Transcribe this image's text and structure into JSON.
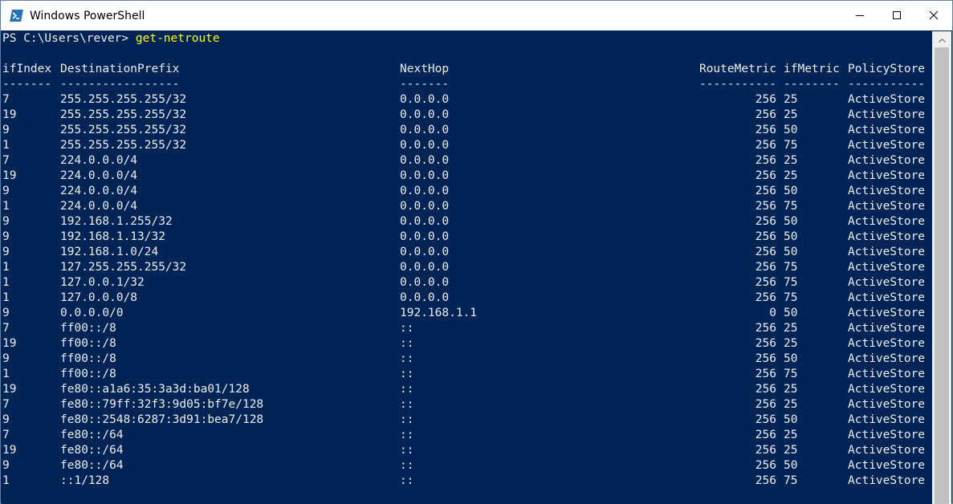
{
  "window": {
    "title": "Windows PowerShell",
    "icon": "powershell-icon",
    "controls": [
      "minimize-icon",
      "maximize-icon",
      "close-icon"
    ]
  },
  "console": {
    "prompt": "PS C:\\Users\\rever> ",
    "command": "get-netroute",
    "headers": {
      "ifIndex": "ifIndex",
      "destination": "DestinationPrefix",
      "nexthop": "NextHop",
      "routemetric": "RouteMetric",
      "ifmetric": "ifMetric",
      "policystore": "PolicyStore"
    },
    "underlines": {
      "ifIndex": "-------",
      "destination": "-----------------",
      "nexthop": "-------",
      "routemetric": "-----------",
      "ifmetric": "--------",
      "policystore": "-----------"
    },
    "rows": [
      {
        "ifIndex": "7",
        "destination": "255.255.255.255/32",
        "nexthop": "0.0.0.0",
        "routemetric": "256",
        "ifmetric": "25",
        "policystore": "ActiveStore"
      },
      {
        "ifIndex": "19",
        "destination": "255.255.255.255/32",
        "nexthop": "0.0.0.0",
        "routemetric": "256",
        "ifmetric": "25",
        "policystore": "ActiveStore"
      },
      {
        "ifIndex": "9",
        "destination": "255.255.255.255/32",
        "nexthop": "0.0.0.0",
        "routemetric": "256",
        "ifmetric": "50",
        "policystore": "ActiveStore"
      },
      {
        "ifIndex": "1",
        "destination": "255.255.255.255/32",
        "nexthop": "0.0.0.0",
        "routemetric": "256",
        "ifmetric": "75",
        "policystore": "ActiveStore"
      },
      {
        "ifIndex": "7",
        "destination": "224.0.0.0/4",
        "nexthop": "0.0.0.0",
        "routemetric": "256",
        "ifmetric": "25",
        "policystore": "ActiveStore"
      },
      {
        "ifIndex": "19",
        "destination": "224.0.0.0/4",
        "nexthop": "0.0.0.0",
        "routemetric": "256",
        "ifmetric": "25",
        "policystore": "ActiveStore"
      },
      {
        "ifIndex": "9",
        "destination": "224.0.0.0/4",
        "nexthop": "0.0.0.0",
        "routemetric": "256",
        "ifmetric": "50",
        "policystore": "ActiveStore"
      },
      {
        "ifIndex": "1",
        "destination": "224.0.0.0/4",
        "nexthop": "0.0.0.0",
        "routemetric": "256",
        "ifmetric": "75",
        "policystore": "ActiveStore"
      },
      {
        "ifIndex": "9",
        "destination": "192.168.1.255/32",
        "nexthop": "0.0.0.0",
        "routemetric": "256",
        "ifmetric": "50",
        "policystore": "ActiveStore"
      },
      {
        "ifIndex": "9",
        "destination": "192.168.1.13/32",
        "nexthop": "0.0.0.0",
        "routemetric": "256",
        "ifmetric": "50",
        "policystore": "ActiveStore"
      },
      {
        "ifIndex": "9",
        "destination": "192.168.1.0/24",
        "nexthop": "0.0.0.0",
        "routemetric": "256",
        "ifmetric": "50",
        "policystore": "ActiveStore"
      },
      {
        "ifIndex": "1",
        "destination": "127.255.255.255/32",
        "nexthop": "0.0.0.0",
        "routemetric": "256",
        "ifmetric": "75",
        "policystore": "ActiveStore"
      },
      {
        "ifIndex": "1",
        "destination": "127.0.0.1/32",
        "nexthop": "0.0.0.0",
        "routemetric": "256",
        "ifmetric": "75",
        "policystore": "ActiveStore"
      },
      {
        "ifIndex": "1",
        "destination": "127.0.0.0/8",
        "nexthop": "0.0.0.0",
        "routemetric": "256",
        "ifmetric": "75",
        "policystore": "ActiveStore"
      },
      {
        "ifIndex": "9",
        "destination": "0.0.0.0/0",
        "nexthop": "192.168.1.1",
        "routemetric": "0",
        "ifmetric": "50",
        "policystore": "ActiveStore"
      },
      {
        "ifIndex": "7",
        "destination": "ff00::/8",
        "nexthop": "::",
        "routemetric": "256",
        "ifmetric": "25",
        "policystore": "ActiveStore"
      },
      {
        "ifIndex": "19",
        "destination": "ff00::/8",
        "nexthop": "::",
        "routemetric": "256",
        "ifmetric": "25",
        "policystore": "ActiveStore"
      },
      {
        "ifIndex": "9",
        "destination": "ff00::/8",
        "nexthop": "::",
        "routemetric": "256",
        "ifmetric": "50",
        "policystore": "ActiveStore"
      },
      {
        "ifIndex": "1",
        "destination": "ff00::/8",
        "nexthop": "::",
        "routemetric": "256",
        "ifmetric": "75",
        "policystore": "ActiveStore"
      },
      {
        "ifIndex": "19",
        "destination": "fe80::a1a6:35:3a3d:ba01/128",
        "nexthop": "::",
        "routemetric": "256",
        "ifmetric": "25",
        "policystore": "ActiveStore"
      },
      {
        "ifIndex": "7",
        "destination": "fe80::79ff:32f3:9d05:bf7e/128",
        "nexthop": "::",
        "routemetric": "256",
        "ifmetric": "25",
        "policystore": "ActiveStore"
      },
      {
        "ifIndex": "9",
        "destination": "fe80::2548:6287:3d91:bea7/128",
        "nexthop": "::",
        "routemetric": "256",
        "ifmetric": "50",
        "policystore": "ActiveStore"
      },
      {
        "ifIndex": "7",
        "destination": "fe80::/64",
        "nexthop": "::",
        "routemetric": "256",
        "ifmetric": "25",
        "policystore": "ActiveStore"
      },
      {
        "ifIndex": "19",
        "destination": "fe80::/64",
        "nexthop": "::",
        "routemetric": "256",
        "ifmetric": "25",
        "policystore": "ActiveStore"
      },
      {
        "ifIndex": "9",
        "destination": "fe80::/64",
        "nexthop": "::",
        "routemetric": "256",
        "ifmetric": "50",
        "policystore": "ActiveStore"
      },
      {
        "ifIndex": "1",
        "destination": "::1/128",
        "nexthop": "::",
        "routemetric": "256",
        "ifmetric": "75",
        "policystore": "ActiveStore"
      }
    ]
  },
  "colors": {
    "console_bg": "#012456",
    "console_text": "#eeedf0",
    "command_text": "#ffff00"
  }
}
